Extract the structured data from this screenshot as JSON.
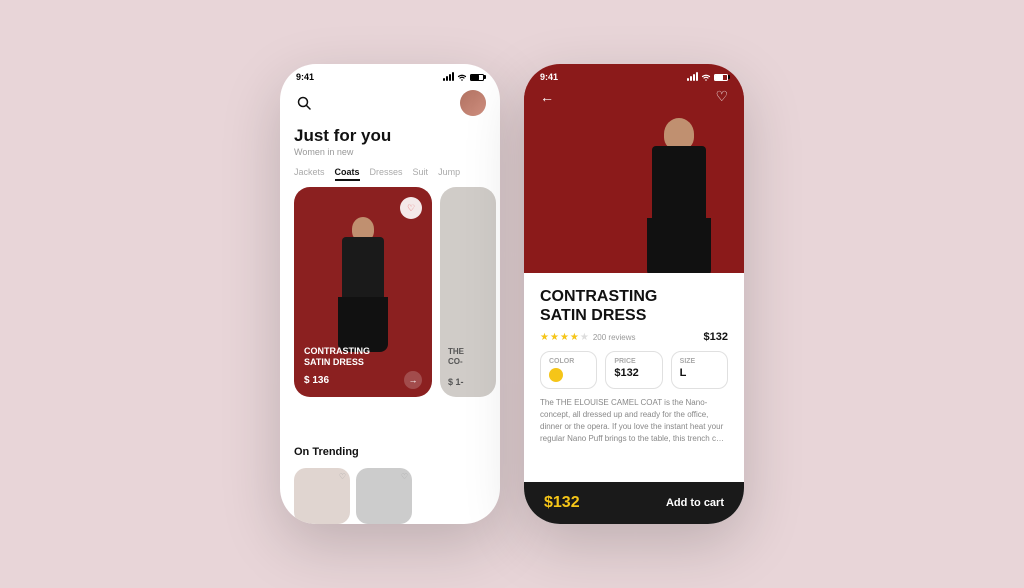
{
  "background": "#e8d5d8",
  "phone1": {
    "status_time": "9:41",
    "header": {
      "avatar_alt": "User avatar"
    },
    "page_title": "Just for you",
    "page_subtitle": "Women in new",
    "categories": [
      "Jackets",
      "Coats",
      "Dresses",
      "Suit",
      "Jump"
    ],
    "active_category": "Coats",
    "product_card": {
      "name": "CONTRASTING\nSATIN DRESS",
      "price": "$ 136",
      "heart_label": "♡"
    },
    "secondary_card": {
      "name": "THE\nCO...",
      "price": "$ 1..."
    },
    "on_trending_label": "On Trending"
  },
  "phone2": {
    "status_time": "9:41",
    "product_title": "CONTRASTING\nSATIN DRESS",
    "rating": {
      "filled": 4,
      "empty": 1,
      "count": "200 reviews"
    },
    "price": "$132",
    "options": {
      "color": {
        "label": "COLOR",
        "value": ""
      },
      "price": {
        "label": "PRICE",
        "value": "$132"
      },
      "size": {
        "label": "SIZE",
        "value": "L"
      }
    },
    "description": "The THE ELOUISE CAMEL COAT is the Nano-concept, all dressed up and ready for the office, dinner or the opera. If you love the instant heat your regular Nano Puff brings to the table, this trench coat length...",
    "cart_price": "$132",
    "add_to_cart_label": "Add to cart",
    "back_icon": "←",
    "heart_icon": "♡"
  }
}
